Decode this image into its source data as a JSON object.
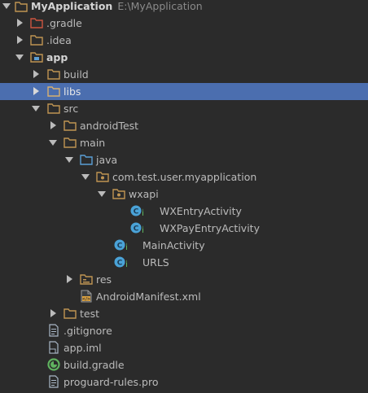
{
  "tree": {
    "root_name": "MyApplication",
    "root_path": "E:\\MyApplication",
    "items": [
      {
        "label": "MyApplication"
      },
      {
        "label": ".gradle"
      },
      {
        "label": ".idea"
      },
      {
        "label": "app"
      },
      {
        "label": "build"
      },
      {
        "label": "libs"
      },
      {
        "label": "src"
      },
      {
        "label": "androidTest"
      },
      {
        "label": "main"
      },
      {
        "label": "java"
      },
      {
        "label": "com.test.user.myapplication"
      },
      {
        "label": "wxapi"
      },
      {
        "label": "WXEntryActivity"
      },
      {
        "label": "WXPayEntryActivity"
      },
      {
        "label": "MainActivity"
      },
      {
        "label": "URLS"
      },
      {
        "label": "res"
      },
      {
        "label": "AndroidManifest.xml"
      },
      {
        "label": "test"
      },
      {
        "label": ".gitignore"
      },
      {
        "label": "app.iml"
      },
      {
        "label": "build.gradle"
      },
      {
        "label": "proguard-rules.pro"
      }
    ]
  },
  "colors": {
    "background": "#2b2b2b",
    "selection": "#4b6eaf",
    "folder": "#c09553",
    "folder_excluded": "#cc5540",
    "source_folder": "#5a9fd6",
    "class_icon": "#4aa3d8",
    "text": "#bbbbbb"
  },
  "icons": {
    "expanded": "chevron-down-icon",
    "collapsed": "chevron-right-icon",
    "folder": "folder-icon",
    "module": "module-folder-icon",
    "source": "source-folder-icon",
    "package": "package-icon",
    "class": "class-c-icon",
    "res": "resource-folder-icon",
    "xml": "xml-file-icon",
    "text_file": "text-file-icon",
    "iml": "iml-file-icon",
    "gradle": "gradle-file-icon"
  }
}
